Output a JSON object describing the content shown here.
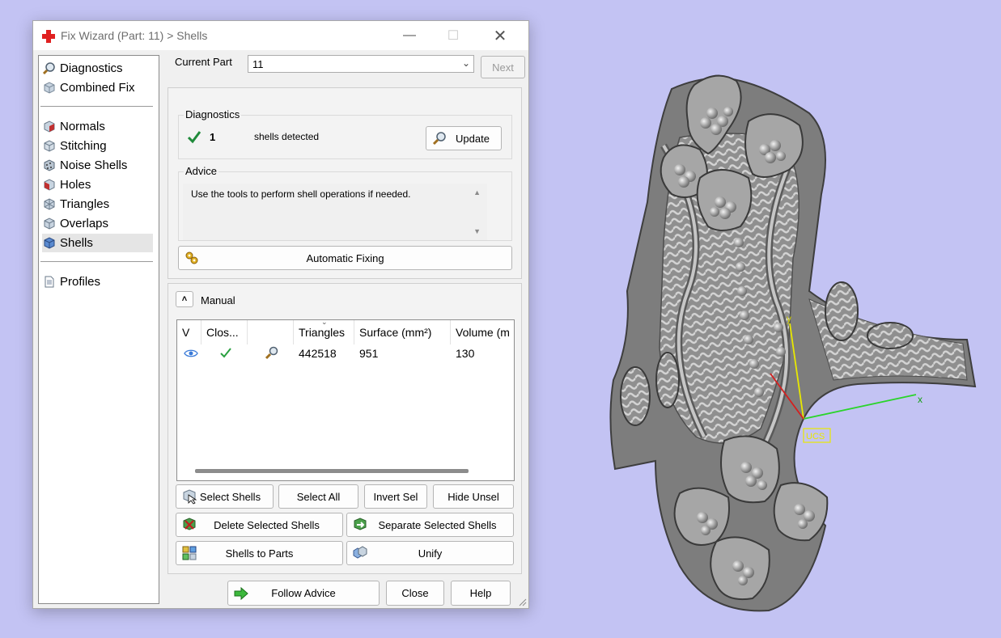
{
  "window": {
    "title": "Fix Wizard (Part: 11) > Shells"
  },
  "nav": {
    "items": [
      {
        "label": "Diagnostics",
        "icon": "magnifier-icon"
      },
      {
        "label": "Combined Fix",
        "icon": "cube-icon"
      },
      {
        "label": "Normals",
        "icon": "normals-cube-icon"
      },
      {
        "label": "Stitching",
        "icon": "stitching-cube-icon"
      },
      {
        "label": "Noise Shells",
        "icon": "noise-shells-icon"
      },
      {
        "label": "Holes",
        "icon": "holes-cube-icon"
      },
      {
        "label": "Triangles",
        "icon": "triangles-cube-icon"
      },
      {
        "label": "Overlaps",
        "icon": "overlaps-cube-icon"
      },
      {
        "label": "Shells",
        "icon": "shells-cube-icon"
      },
      {
        "label": "Profiles",
        "icon": "document-icon"
      }
    ],
    "active": "Shells"
  },
  "current_part": {
    "label": "Current Part",
    "value": "11",
    "next_label": "Next"
  },
  "diagnostics": {
    "title": "Diagnostics",
    "count": "1",
    "text": "shells detected",
    "update_label": "Update"
  },
  "advice": {
    "title": "Advice",
    "text": "Use the tools to perform shell operations if needed."
  },
  "automatic_fixing_label": "Automatic Fixing",
  "manual": {
    "label": "Manual",
    "columns": [
      "V",
      "Clos...",
      "",
      "Triangles",
      "Surface (mm²)",
      "Volume (m"
    ],
    "row": {
      "triangles": "442518",
      "surface": "951",
      "volume": "130"
    }
  },
  "buttons": {
    "select_shells": "Select Shells",
    "select_all": "Select All",
    "invert_sel": "Invert Sel",
    "hide_unsel": "Hide Unsel",
    "delete_selected": "Delete Selected Shells",
    "separate_selected": "Separate Selected Shells",
    "shells_to_parts": "Shells to Parts",
    "unify": "Unify",
    "follow_advice": "Follow Advice",
    "close": "Close",
    "help": "Help"
  },
  "viewport": {
    "axis_x": "x",
    "axis_y": "y",
    "ucs_label": "UCS"
  },
  "colors": {
    "background": "#c3c3f3",
    "model": "#9a9a9a",
    "axis_x": "#22cc22",
    "axis_y": "#e8e800"
  }
}
